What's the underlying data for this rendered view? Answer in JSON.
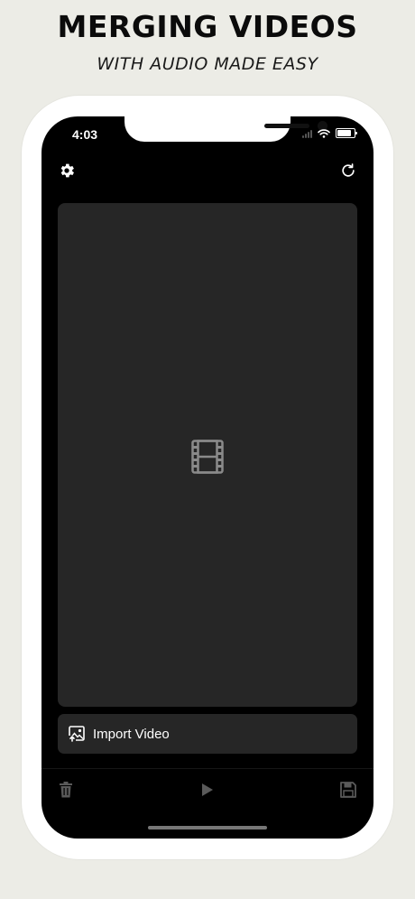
{
  "promo": {
    "headline": "MERGING VIDEOS",
    "subheadline": "WITH AUDIO MADE EASY"
  },
  "status_bar": {
    "time": "4:03",
    "icons": [
      "cellular-icon",
      "wifi-icon",
      "battery-icon"
    ]
  },
  "top_bar": {
    "left_icon": "gear-icon",
    "right_icon": "refresh-icon"
  },
  "preview": {
    "placeholder_icon": "film-icon"
  },
  "import": {
    "label": "Import Video",
    "icon": "image-import-icon"
  },
  "bottom_toolbar": {
    "icons": [
      "trash-icon",
      "play-icon",
      "save-icon"
    ]
  },
  "colors": {
    "page_background": "#ecece6",
    "screen_background": "#000000",
    "panel_background": "#262626",
    "active_icon": "#ffffff",
    "inactive_icon": "#5a5a5a"
  }
}
